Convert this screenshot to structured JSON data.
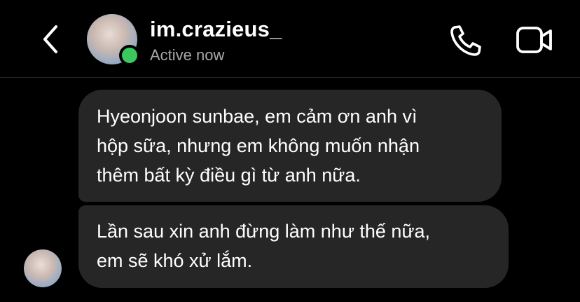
{
  "header": {
    "username": "im.crazieus_",
    "status": "Active now",
    "back_icon": "chevron-left-icon",
    "call_icon": "phone-icon",
    "video_icon": "video-camera-icon",
    "active_color": "#3ac95d"
  },
  "messages": [
    {
      "lines": [
        "Hyeonjoon sunbae, em cảm ơn anh vì",
        "hộp sữa, nhưng em không muốn nhận",
        "thêm bất kỳ điều gì từ anh nữa."
      ]
    },
    {
      "lines": [
        "Lần sau xin anh đừng làm như thế nữa,",
        "em sẽ khó xử lắm."
      ]
    }
  ],
  "colors": {
    "background": "#000000",
    "bubble": "#262626",
    "secondary_text": "#a8a8a8"
  }
}
